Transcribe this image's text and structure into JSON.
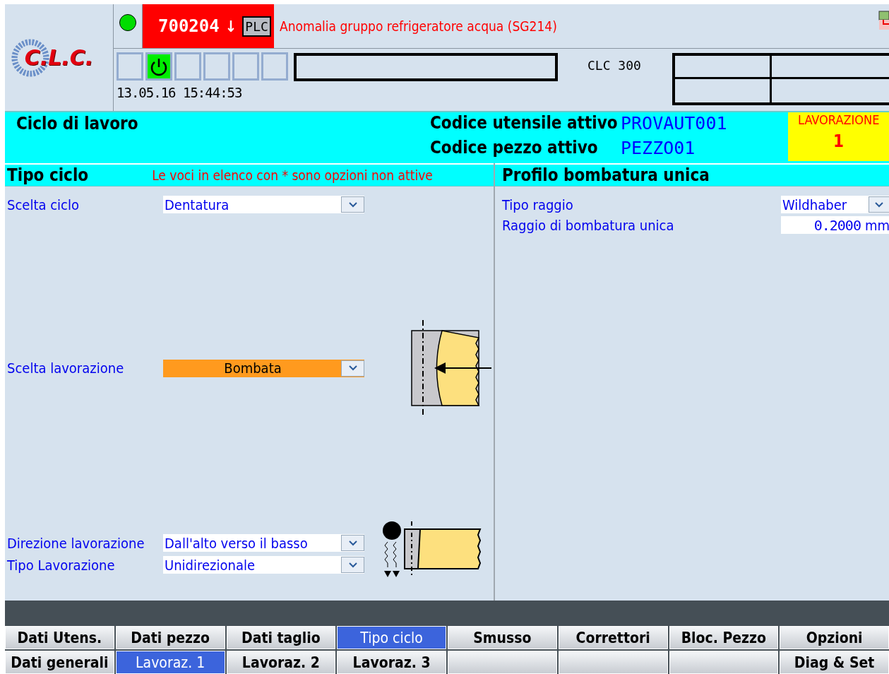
{
  "logo": {
    "text": "C.L.C."
  },
  "alarm": {
    "number": "700204",
    "arrow": "↓",
    "source": "PLC",
    "message": "Anomalia gruppo refrigeratore acqua (SG214)"
  },
  "mode_slots": [
    {
      "active": false
    },
    {
      "active": true
    },
    {
      "active": false
    },
    {
      "active": false
    },
    {
      "active": false
    },
    {
      "active": false
    }
  ],
  "datetime": "13.05.16 15:44:53",
  "machine": "CLC 300",
  "title_bar": {
    "title": "Ciclo di lavoro",
    "fields": [
      {
        "label": "Codice utensile attivo",
        "value": "PROVAUT001"
      },
      {
        "label": "Codice pezzo attivo",
        "value": "PEZZO01"
      }
    ],
    "status": {
      "label": "LAVORAZIONE",
      "value": "1"
    }
  },
  "left_panel": {
    "title": "Tipo ciclo",
    "note": "Le voci in elenco con * sono opzioni non attive",
    "fields": [
      {
        "label": "Scelta ciclo",
        "value": "Dentatura",
        "highlighted": false
      },
      {
        "label": "Scelta lavorazione",
        "value": "Bombata",
        "highlighted": true
      },
      {
        "label": "Direzione lavorazione",
        "value": "Dall'alto verso il basso",
        "highlighted": false
      },
      {
        "label": "Tipo Lavorazione",
        "value": "Unidirezionale",
        "highlighted": false
      }
    ]
  },
  "right_panel": {
    "title": "Profilo bombatura unica",
    "fields": [
      {
        "kind": "dropdown",
        "label": "Tipo raggio",
        "value": "Wildhaber"
      },
      {
        "kind": "number",
        "label": "Raggio di bombatura unica",
        "value": "0.2000",
        "unit": "mm"
      }
    ]
  },
  "softkeys": [
    [
      {
        "label": "Dati Utens.",
        "selected": false
      },
      {
        "label": "Dati pezzo",
        "selected": false
      },
      {
        "label": "Dati taglio",
        "selected": false
      },
      {
        "label": "Tipo ciclo",
        "selected": true
      },
      {
        "label": "Smusso",
        "selected": false
      },
      {
        "label": "Correttori",
        "selected": false
      },
      {
        "label": "Bloc. Pezzo",
        "selected": false
      },
      {
        "label": "Opzioni",
        "selected": false
      }
    ],
    [
      {
        "label": "Dati generali",
        "selected": false
      },
      {
        "label": "Lavoraz. 1",
        "selected": true
      },
      {
        "label": "Lavoraz. 2",
        "selected": false
      },
      {
        "label": "Lavoraz. 3",
        "selected": false
      },
      {
        "selected": false
      },
      {
        "selected": false
      },
      {
        "selected": false
      },
      {
        "label": "Diag & Set",
        "selected": false
      }
    ]
  ]
}
